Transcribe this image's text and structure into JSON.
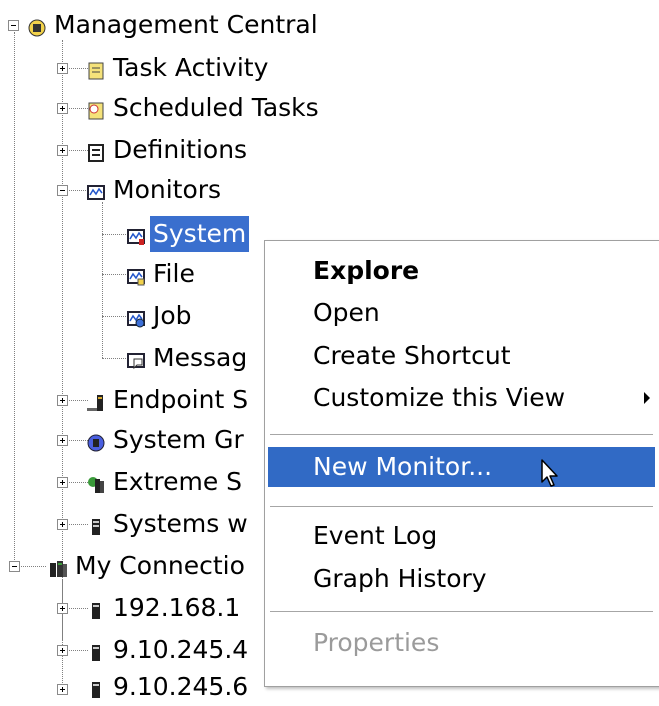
{
  "tree": {
    "root": "Management Central",
    "items": [
      {
        "label": "Task Activity"
      },
      {
        "label": "Scheduled Tasks"
      },
      {
        "label": "Definitions"
      },
      {
        "label": "Monitors"
      },
      {
        "label": "System"
      },
      {
        "label": "File"
      },
      {
        "label": "Job"
      },
      {
        "label": "Messag"
      },
      {
        "label": "Endpoint S"
      },
      {
        "label": "System Gr"
      },
      {
        "label": "Extreme S"
      },
      {
        "label": "Systems w"
      },
      {
        "label": "My Connectio"
      },
      {
        "label": "192.168.1"
      },
      {
        "label": "9.10.245.4"
      },
      {
        "label": "9.10.245.6"
      }
    ]
  },
  "context_menu": {
    "explore": "Explore",
    "open": "Open",
    "create_shortcut": "Create Shortcut",
    "customize_view": "Customize this View",
    "new_monitor": "New Monitor...",
    "event_log": "Event Log",
    "graph_history": "Graph History",
    "properties": "Properties"
  },
  "colors": {
    "selection": "#3a6fce",
    "menu_highlight": "#316ac5",
    "disabled_text": "#9b9b9b"
  }
}
